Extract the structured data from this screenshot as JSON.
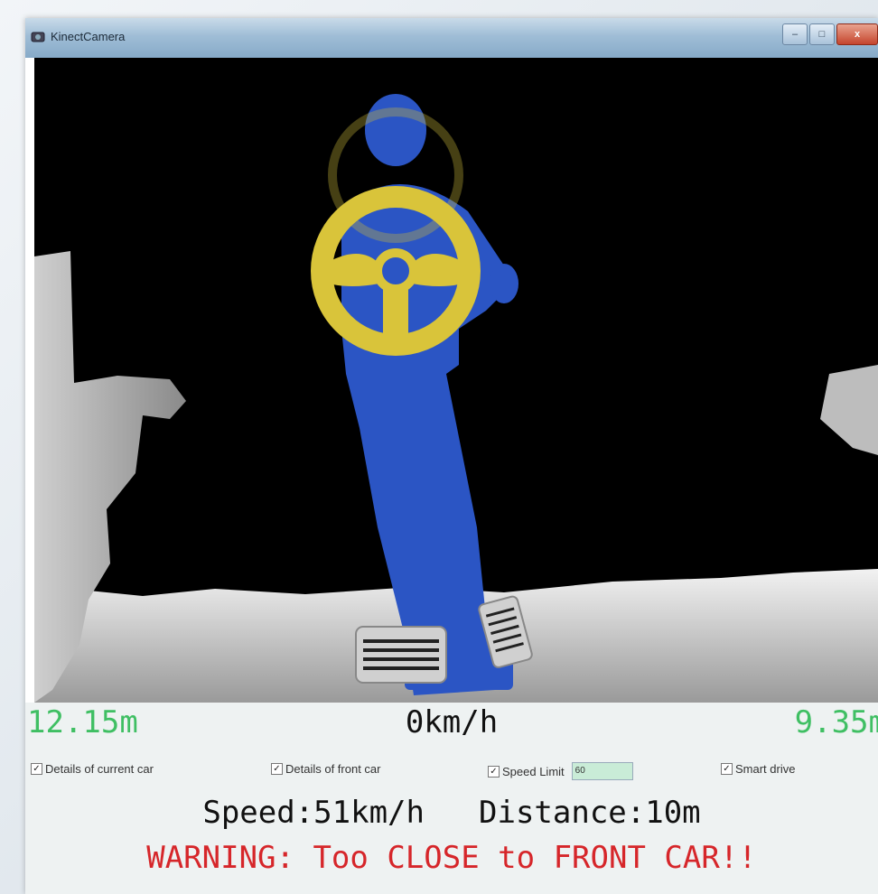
{
  "window": {
    "title": "KinectCamera",
    "controls": {
      "minimize": "–",
      "maximize": "□",
      "close": "x"
    }
  },
  "readouts": {
    "left_distance": "12.15m",
    "current_speed": "0km/h",
    "right_distance": "9.35m"
  },
  "options": [
    {
      "label": "Details of current car",
      "checked": true
    },
    {
      "label": "Details of front car",
      "checked": true
    },
    {
      "label": "Speed Limit",
      "checked": true
    },
    {
      "label": "Smart drive",
      "checked": true
    }
  ],
  "speed_limit_value": "60",
  "front_car": {
    "speed": "Speed:51km/h",
    "distance": "Distance:10m"
  },
  "warning": "WARNING: Too CLOSE to FRONT CAR!!",
  "colors": {
    "user_silhouette": "#2b55c4",
    "wheel": "#d9c43a",
    "distance_text": "#3fbf63",
    "warning_text": "#d6262a"
  },
  "icons": [
    "app-icon",
    "steering-wheel-icon",
    "brake-pedal-icon",
    "accelerator-pedal-icon"
  ]
}
